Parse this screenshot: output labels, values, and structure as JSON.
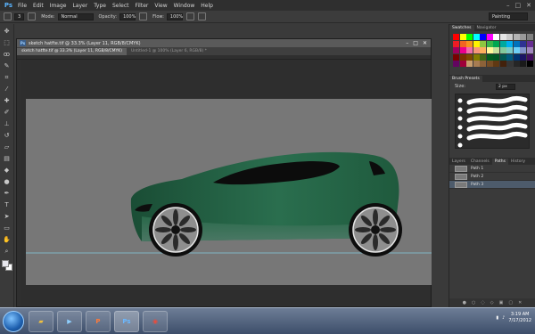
{
  "app": {
    "logo": "Ps"
  },
  "menu": [
    "File",
    "Edit",
    "Image",
    "Layer",
    "Type",
    "Select",
    "Filter",
    "View",
    "Window",
    "Help"
  ],
  "window_controls": {
    "minimize": "–",
    "maximize": "□",
    "close": "✕"
  },
  "options_bar": {
    "mode_label": "Mode:",
    "mode_value": "Normal",
    "opacity_label": "Opacity:",
    "opacity_value": "100%",
    "flow_label": "Flow:",
    "flow_value": "100%",
    "brush_size": "3",
    "workspace": "Painting"
  },
  "tools": [
    "move-icon",
    "marquee-icon",
    "lasso-icon",
    "quick-select-icon",
    "crop-icon",
    "eyedropper-icon",
    "healing-icon",
    "brush-icon",
    "stamp-icon",
    "history-brush-icon",
    "eraser-icon",
    "gradient-icon",
    "blur-icon",
    "dodge-icon",
    "pen-icon",
    "type-icon",
    "path-select-icon",
    "shape-icon",
    "hand-icon",
    "zoom-icon"
  ],
  "document": {
    "title": "sketch hatfte.tif @ 33.3% (Layer 11, RGB/8/CMYK)",
    "tabs": [
      {
        "label": "sketch hatfte.tif @ 33.3% (Layer 11, RGB/8/CMYK)",
        "active": true
      },
      {
        "label": "Untitled-1 @ 100% (Layer 6, RGB/8) *",
        "active": false
      }
    ]
  },
  "panels": {
    "top_tabs": [
      "Swatches",
      "Navigator"
    ],
    "brush_presets": {
      "title": "Brush Presets",
      "size_label": "Size:",
      "size_value": "2 px"
    },
    "paths_tabs": [
      "Layers",
      "Channels",
      "Paths",
      "History"
    ],
    "paths": [
      "Path 1",
      "Path 2",
      "Path 3"
    ]
  },
  "colors": {
    "car_body": "#1f5a3d",
    "canvas": "#777777",
    "accent": "#4d5b6b"
  },
  "taskbar": {
    "apps": [
      "explorer",
      "media",
      "powerpoint",
      "photoshop",
      "chrome"
    ],
    "app_labels": [
      "",
      "",
      "P",
      "Ps",
      ""
    ],
    "time": "3:19 AM",
    "date": "7/17/2012"
  }
}
